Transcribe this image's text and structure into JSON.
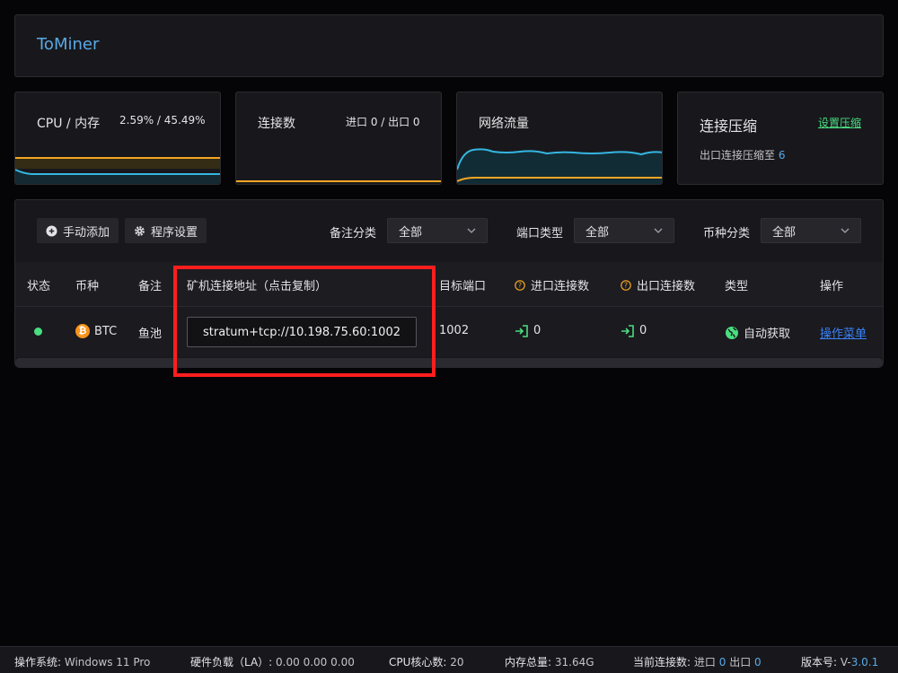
{
  "header": {
    "title": "ToMiner"
  },
  "cards": {
    "cpu": {
      "label": "CPU / 内存",
      "value": "2.59% / 45.49%"
    },
    "connections": {
      "label": "连接数",
      "value": "进口 0 / 出口 0"
    },
    "network": {
      "label": "网络流量"
    },
    "compression": {
      "label": "连接压缩",
      "link": "设置压缩",
      "sub_prefix": "出口连接压缩至",
      "sub_value": "6"
    }
  },
  "toolbar": {
    "add_label": "手动添加",
    "settings_label": "程序设置",
    "filters": [
      {
        "label": "备注分类",
        "value": "全部"
      },
      {
        "label": "端口类型",
        "value": "全部"
      },
      {
        "label": "币种分类",
        "value": "全部"
      }
    ]
  },
  "table": {
    "columns": [
      "状态",
      "币种",
      "备注",
      "矿机连接地址（点击复制）",
      "目标端口",
      "进口连接数",
      "出口连接数",
      "类型",
      "操作"
    ],
    "rows": [
      {
        "coin": "BTC",
        "note": "鱼池",
        "address": "stratum+tcp://10.198.75.60:1002",
        "port": "1002",
        "in": "0",
        "out": "0",
        "type": "自动获取",
        "action": "操作菜单"
      }
    ]
  },
  "footer": {
    "os_label": "操作系统:",
    "os_value": "Windows 11 Pro",
    "load_label": "硬件负载（LA）:",
    "load_value": "0.00 0.00 0.00",
    "cores_label": "CPU核心数:",
    "cores_value": "20",
    "mem_label": "内存总量:",
    "mem_value": "31.64G",
    "conn_label": "当前连接数:",
    "conn_in_label": "进口",
    "conn_in": "0",
    "conn_out_label": "出口",
    "conn_out": "0",
    "version_label": "版本号:",
    "version_prefix": "V-",
    "version_value": "3.0.1"
  },
  "colors": {
    "accent_blue": "#5aa9e6",
    "accent_green": "#4ade80",
    "accent_orange": "#f5a623",
    "highlight_red": "#ff1e1e"
  }
}
